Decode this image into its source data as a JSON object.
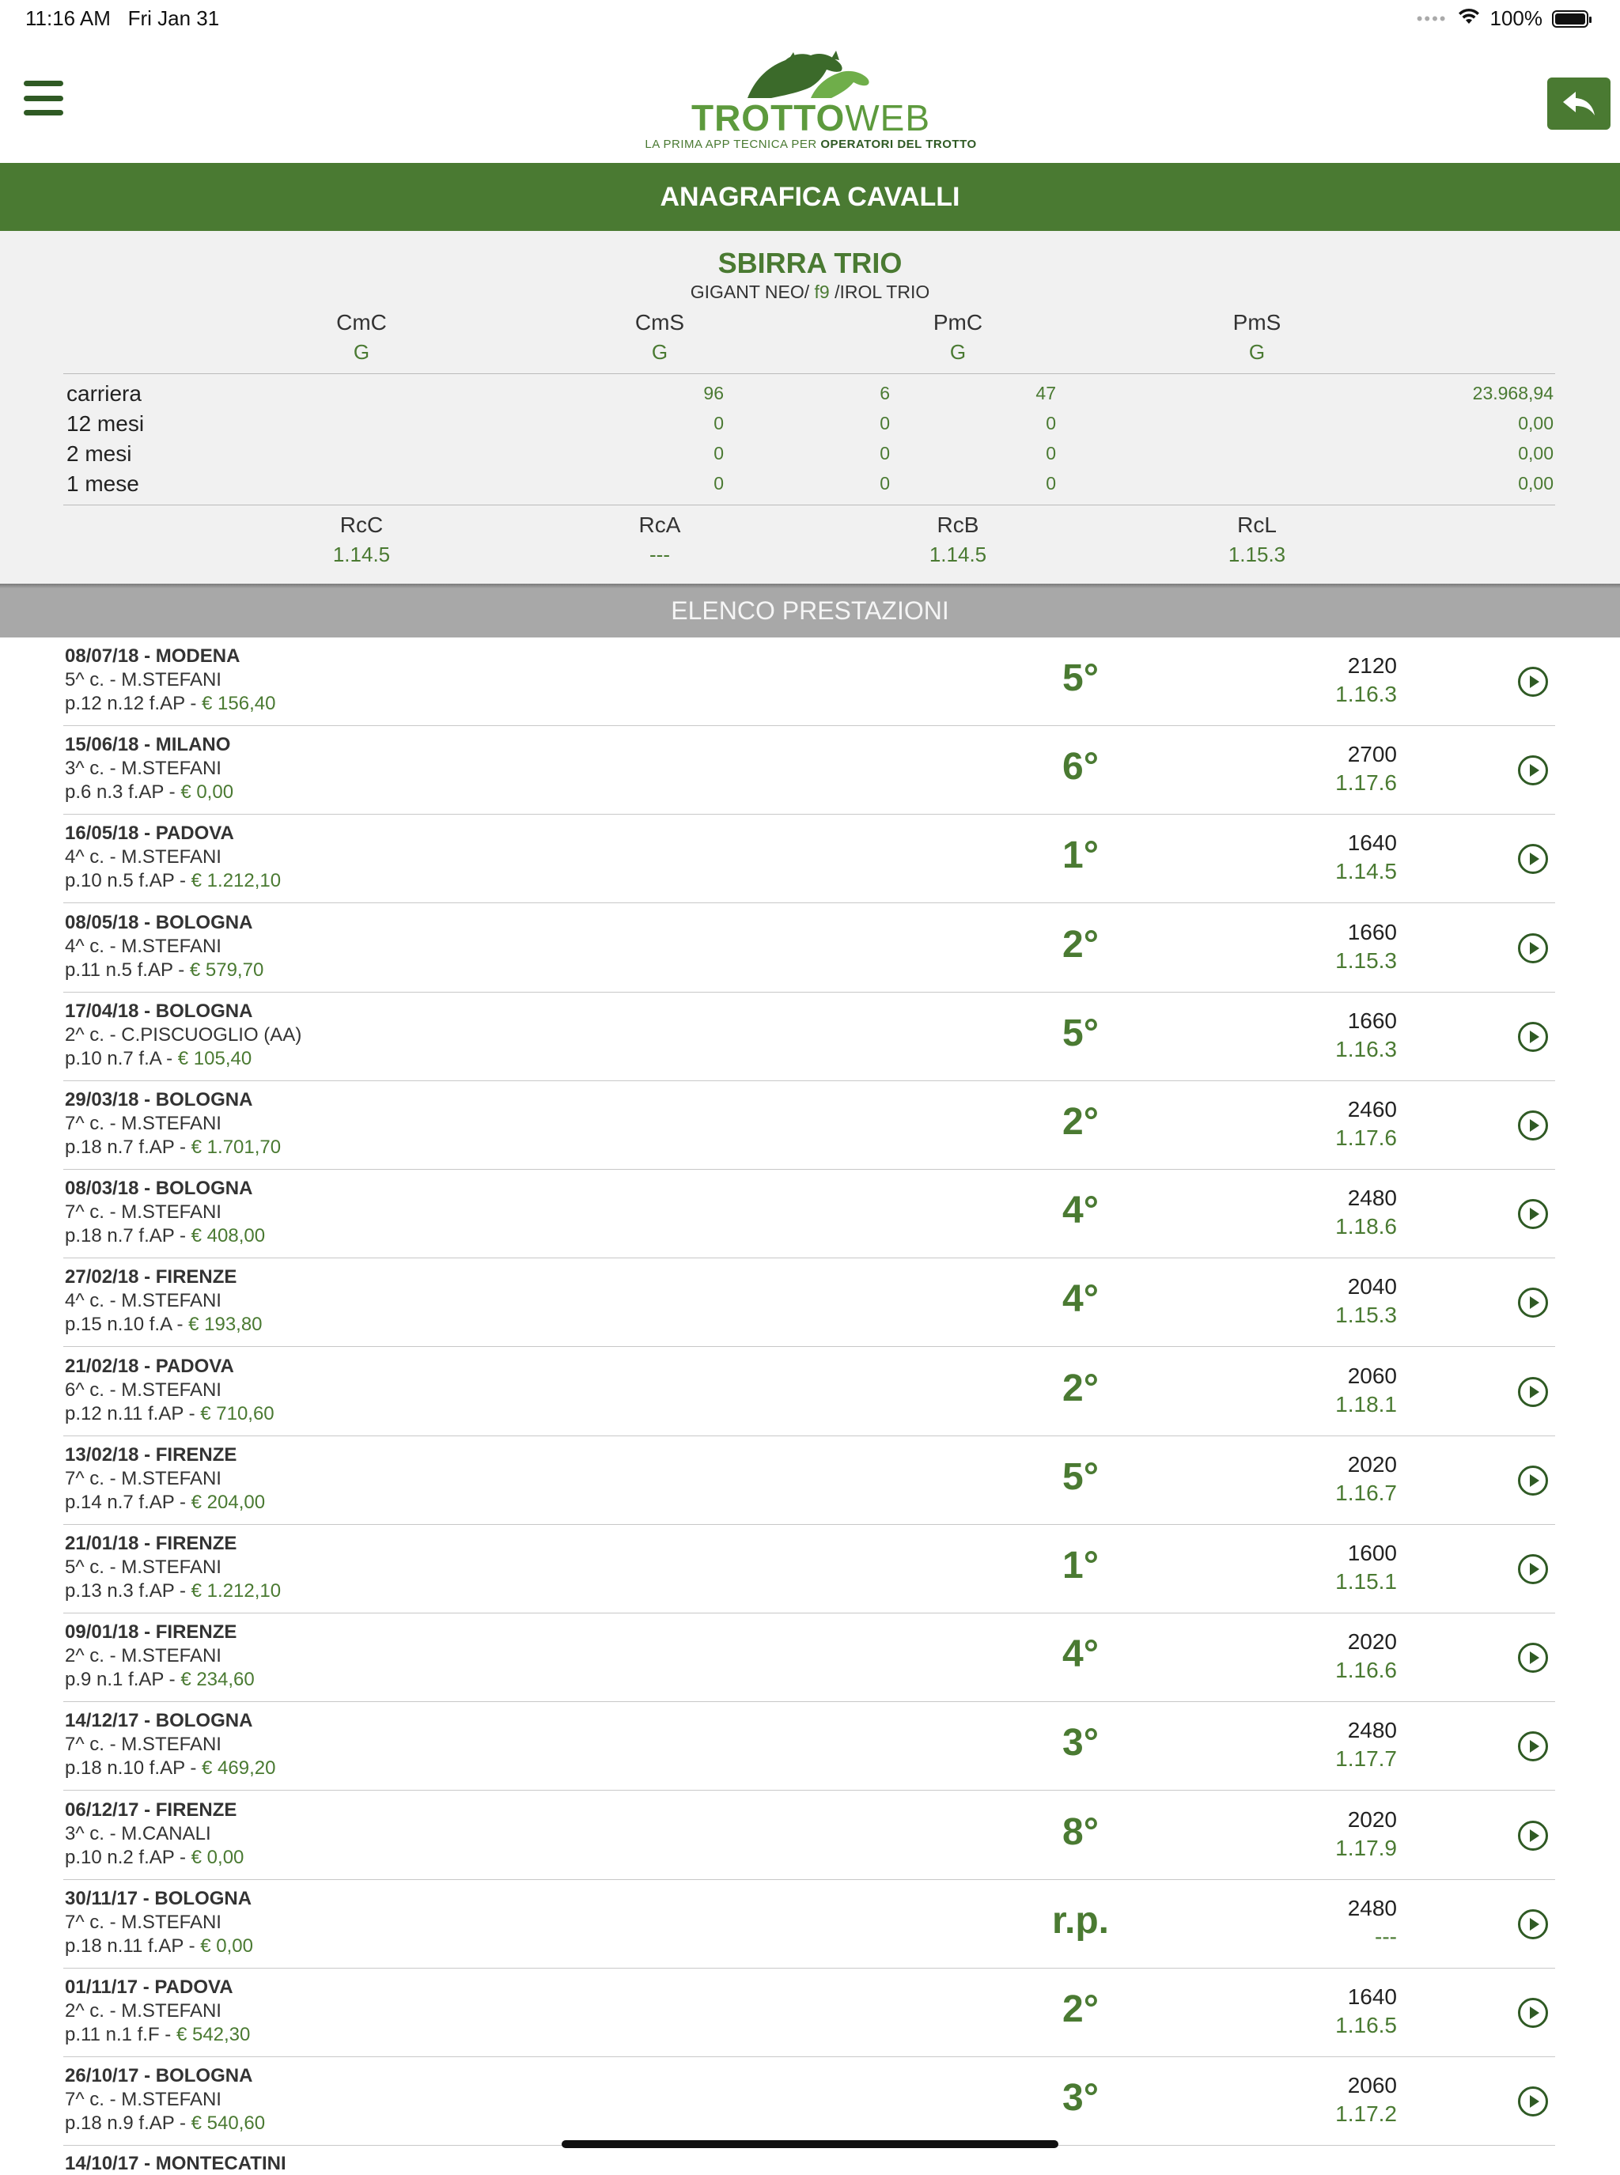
{
  "status": {
    "time": "11:16 AM",
    "date": "Fri Jan 31",
    "battery": "100%"
  },
  "logo": {
    "brand_main": "TROTTO",
    "brand_web": "WEB",
    "tagline_a": "LA PRIMA APP TECNICA PER ",
    "tagline_b": "OPERATORI DEL TROTTO"
  },
  "page_title": "ANAGRAFICA CAVALLI",
  "horse": {
    "name": "SBIRRA TRIO",
    "sire": "GIGANT NEO/ ",
    "sex_age": "f9",
    "dam": " /IROL TRIO",
    "headers": [
      {
        "label": "CmC",
        "value": "G"
      },
      {
        "label": "CmS",
        "value": "G"
      },
      {
        "label": "PmC",
        "value": "G"
      },
      {
        "label": "PmS",
        "value": "G"
      }
    ],
    "stats": [
      {
        "label": "carriera",
        "a": "96",
        "b": "6",
        "c": "47",
        "total": "23.968,94"
      },
      {
        "label": "12 mesi",
        "a": "0",
        "b": "0",
        "c": "0",
        "total": "0,00"
      },
      {
        "label": "2 mesi",
        "a": "0",
        "b": "0",
        "c": "0",
        "total": "0,00"
      },
      {
        "label": "1 mese",
        "a": "0",
        "b": "0",
        "c": "0",
        "total": "0,00"
      }
    ],
    "records": [
      {
        "label": "RcC",
        "value": "1.14.5"
      },
      {
        "label": "RcA",
        "value": "---"
      },
      {
        "label": "RcB",
        "value": "1.14.5"
      },
      {
        "label": "RcL",
        "value": "1.15.3"
      }
    ]
  },
  "section_title": "ELENCO PRESTAZIONI",
  "races": [
    {
      "line1": "08/07/18 - MODENA",
      "line2": "5^ c. - M.STEFANI",
      "line3": "p.12 n.12 f.AP - ",
      "amount": "€ 156,40",
      "place": "5°",
      "dist": "2120",
      "time": "1.16.3"
    },
    {
      "line1": "15/06/18 - MILANO",
      "line2": "3^ c. - M.STEFANI",
      "line3": "p.6 n.3 f.AP - ",
      "amount": "€ 0,00",
      "place": "6°",
      "dist": "2700",
      "time": "1.17.6"
    },
    {
      "line1": "16/05/18 - PADOVA",
      "line2": "4^ c. - M.STEFANI",
      "line3": "p.10 n.5 f.AP - ",
      "amount": "€ 1.212,10",
      "place": "1°",
      "dist": "1640",
      "time": "1.14.5"
    },
    {
      "line1": "08/05/18 - BOLOGNA",
      "line2": "4^ c. - M.STEFANI",
      "line3": "p.11 n.5 f.AP - ",
      "amount": "€ 579,70",
      "place": "2°",
      "dist": "1660",
      "time": "1.15.3"
    },
    {
      "line1": "17/04/18 - BOLOGNA",
      "line2": "2^ c. - C.PISCUOGLIO (AA)",
      "line3": "p.10 n.7 f.A - ",
      "amount": "€ 105,40",
      "place": "5°",
      "dist": "1660",
      "time": "1.16.3"
    },
    {
      "line1": "29/03/18 - BOLOGNA",
      "line2": "7^ c. - M.STEFANI",
      "line3": "p.18 n.7 f.AP - ",
      "amount": "€ 1.701,70",
      "place": "2°",
      "dist": "2460",
      "time": "1.17.6"
    },
    {
      "line1": "08/03/18 - BOLOGNA",
      "line2": "7^ c. - M.STEFANI",
      "line3": "p.18 n.7 f.AP - ",
      "amount": "€ 408,00",
      "place": "4°",
      "dist": "2480",
      "time": "1.18.6"
    },
    {
      "line1": "27/02/18 - FIRENZE",
      "line2": "4^ c. - M.STEFANI",
      "line3": "p.15 n.10 f.A - ",
      "amount": "€ 193,80",
      "place": "4°",
      "dist": "2040",
      "time": "1.15.3"
    },
    {
      "line1": "21/02/18 - PADOVA",
      "line2": "6^ c. - M.STEFANI",
      "line3": "p.12 n.11 f.AP - ",
      "amount": "€ 710,60",
      "place": "2°",
      "dist": "2060",
      "time": "1.18.1"
    },
    {
      "line1": "13/02/18 - FIRENZE",
      "line2": "7^ c. - M.STEFANI",
      "line3": "p.14 n.7 f.AP - ",
      "amount": "€ 204,00",
      "place": "5°",
      "dist": "2020",
      "time": "1.16.7"
    },
    {
      "line1": "21/01/18 - FIRENZE",
      "line2": "5^ c. - M.STEFANI",
      "line3": "p.13 n.3 f.AP - ",
      "amount": "€ 1.212,10",
      "place": "1°",
      "dist": "1600",
      "time": "1.15.1"
    },
    {
      "line1": "09/01/18 - FIRENZE",
      "line2": "2^ c. - M.STEFANI",
      "line3": "p.9 n.1 f.AP - ",
      "amount": "€ 234,60",
      "place": "4°",
      "dist": "2020",
      "time": "1.16.6"
    },
    {
      "line1": "14/12/17 - BOLOGNA",
      "line2": "7^ c. - M.STEFANI",
      "line3": "p.18 n.10 f.AP - ",
      "amount": "€ 469,20",
      "place": "3°",
      "dist": "2480",
      "time": "1.17.7"
    },
    {
      "line1": "06/12/17 - FIRENZE",
      "line2": "3^ c. - M.CANALI",
      "line3": "p.10 n.2 f.AP - ",
      "amount": "€ 0,00",
      "place": "8°",
      "dist": "2020",
      "time": "1.17.9"
    },
    {
      "line1": "30/11/17 - BOLOGNA",
      "line2": "7^ c. - M.STEFANI",
      "line3": "p.18 n.11 f.AP - ",
      "amount": "€ 0,00",
      "place": "r.p.",
      "dist": "2480",
      "time": "---"
    },
    {
      "line1": "01/11/17 - PADOVA",
      "line2": "2^ c. - M.STEFANI",
      "line3": "p.11 n.1 f.F - ",
      "amount": "€ 542,30",
      "place": "2°",
      "dist": "1640",
      "time": "1.16.5"
    },
    {
      "line1": "26/10/17 - BOLOGNA",
      "line2": "7^ c. - M.STEFANI",
      "line3": "p.18 n.9 f.AP - ",
      "amount": "€ 540,60",
      "place": "3°",
      "dist": "2060",
      "time": "1.17.2"
    }
  ],
  "peek_row": "14/10/17 - MONTECATINI"
}
